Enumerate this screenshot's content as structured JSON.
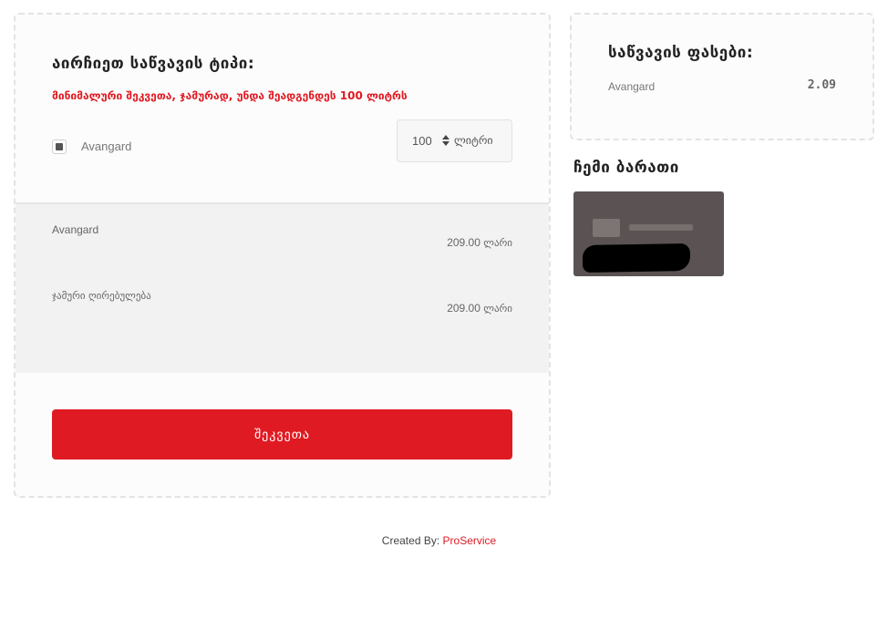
{
  "order": {
    "title": "აირჩიეთ საწვავის ტიპი:",
    "min_order_note": "მინიმალური შეკვეთა, ჯამურად, უნდა შეადგენდეს 100 ლიტრს",
    "fuel_option": {
      "label": "Avangard",
      "checked": true
    },
    "quantity": {
      "value": "100",
      "unit": "ლიტრი"
    },
    "summary": {
      "line_item": {
        "label": "Avangard",
        "amount": "209.00",
        "unit": "ლარი"
      },
      "total": {
        "label": "ჯამური ღირებულება",
        "amount": "209.00",
        "unit": "ლარი"
      }
    },
    "submit_label": "შეკვეთა"
  },
  "prices": {
    "title": "საწვავის ფასები:",
    "items": [
      {
        "name": "Avangard",
        "price": "2.09"
      }
    ]
  },
  "card": {
    "title": "ჩემი ბარათი"
  },
  "footer": {
    "prefix": "Created By:",
    "link_text": "ProService"
  },
  "colors": {
    "accent": "#e01a22",
    "card_bg": "#5b5353",
    "summary_bg": "#f2f2f2"
  }
}
